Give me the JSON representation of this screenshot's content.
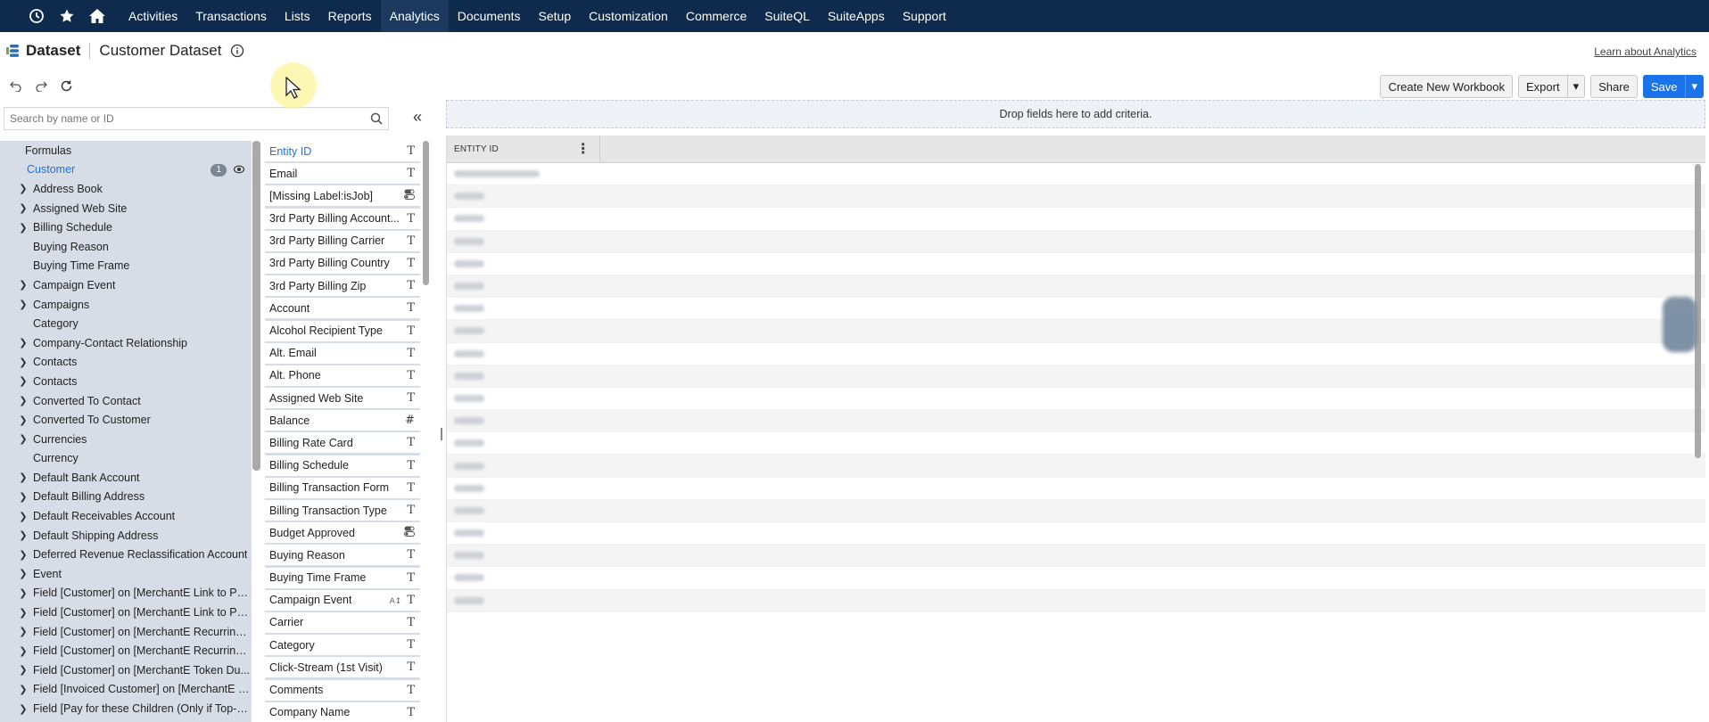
{
  "nav": {
    "items": [
      "Activities",
      "Transactions",
      "Lists",
      "Reports",
      "Analytics",
      "Documents",
      "Setup",
      "Customization",
      "Commerce",
      "SuiteQL",
      "SuiteApps",
      "Support"
    ],
    "active": "Analytics"
  },
  "header": {
    "title": "Dataset",
    "subtitle": "Customer Dataset",
    "learn_link": "Learn about Analytics"
  },
  "actions": {
    "create_workbook": "Create New Workbook",
    "export": "Export",
    "share": "Share",
    "save": "Save"
  },
  "search": {
    "placeholder": "Search by name or ID"
  },
  "tree": {
    "formulas": "Formulas",
    "customer": "Customer",
    "customer_badge": "1",
    "items": [
      {
        "label": "Address Book",
        "expandable": true
      },
      {
        "label": "Assigned Web Site",
        "expandable": true
      },
      {
        "label": "Billing Schedule",
        "expandable": true
      },
      {
        "label": "Buying Reason",
        "expandable": false
      },
      {
        "label": "Buying Time Frame",
        "expandable": false
      },
      {
        "label": "Campaign Event",
        "expandable": true
      },
      {
        "label": "Campaigns",
        "expandable": true
      },
      {
        "label": "Category",
        "expandable": false
      },
      {
        "label": "Company-Contact Relationship",
        "expandable": true
      },
      {
        "label": "Contacts",
        "expandable": true
      },
      {
        "label": "Contacts",
        "expandable": true
      },
      {
        "label": "Converted To Contact",
        "expandable": true
      },
      {
        "label": "Converted To Customer",
        "expandable": true
      },
      {
        "label": "Currencies",
        "expandable": true
      },
      {
        "label": "Currency",
        "expandable": false
      },
      {
        "label": "Default Bank Account",
        "expandable": true
      },
      {
        "label": "Default Billing Address",
        "expandable": true
      },
      {
        "label": "Default Receivables Account",
        "expandable": true
      },
      {
        "label": "Default Shipping Address",
        "expandable": true
      },
      {
        "label": "Deferred Revenue Reclassification Account",
        "expandable": true
      },
      {
        "label": "Event",
        "expandable": true
      },
      {
        "label": "Field [Customer] on [MerchantE Link to Pa...",
        "expandable": true
      },
      {
        "label": "Field [Customer] on [MerchantE Link to Pa...",
        "expandable": true
      },
      {
        "label": "Field [Customer] on [MerchantE Recurring ...",
        "expandable": true
      },
      {
        "label": "Field [Customer] on [MerchantE Recurring ...",
        "expandable": true
      },
      {
        "label": "Field [Customer] on [MerchantE Token Du...",
        "expandable": true
      },
      {
        "label": "Field [Invoiced Customer] on [MerchantE R...",
        "expandable": true
      },
      {
        "label": "Field [Pay for these Children (Only if Top-Le...",
        "expandable": true
      }
    ]
  },
  "fields": [
    {
      "label": "Entity ID",
      "type": "text",
      "active": true
    },
    {
      "label": "Email",
      "type": "text"
    },
    {
      "label": "[Missing Label:isJob]",
      "type": "toggle"
    },
    {
      "label": "3rd Party Billing Account...",
      "type": "text"
    },
    {
      "label": "3rd Party Billing Carrier",
      "type": "text"
    },
    {
      "label": "3rd Party Billing Country",
      "type": "text"
    },
    {
      "label": "3rd Party Billing Zip",
      "type": "text"
    },
    {
      "label": "Account",
      "type": "text"
    },
    {
      "label": "Alcohol Recipient Type",
      "type": "text"
    },
    {
      "label": "Alt. Email",
      "type": "text"
    },
    {
      "label": "Alt. Phone",
      "type": "text"
    },
    {
      "label": "Assigned Web Site",
      "type": "text"
    },
    {
      "label": "Balance",
      "type": "number"
    },
    {
      "label": "Billing Rate Card",
      "type": "text"
    },
    {
      "label": "Billing Schedule",
      "type": "text"
    },
    {
      "label": "Billing Transaction Form",
      "type": "text"
    },
    {
      "label": "Billing Transaction Type",
      "type": "text"
    },
    {
      "label": "Budget Approved",
      "type": "toggle"
    },
    {
      "label": "Buying Reason",
      "type": "text"
    },
    {
      "label": "Buying Time Frame",
      "type": "text"
    },
    {
      "label": "Campaign Event",
      "type": "sort-text"
    },
    {
      "label": "Carrier",
      "type": "text"
    },
    {
      "label": "Category",
      "type": "text"
    },
    {
      "label": "Click-Stream (1st Visit)",
      "type": "text"
    },
    {
      "label": "Comments",
      "type": "text"
    },
    {
      "label": "Company Name",
      "type": "text"
    }
  ],
  "criteria": {
    "drop_hint": "Drop fields here to add criteria."
  },
  "grid": {
    "column": "ENTITY ID",
    "rows": 20
  },
  "colors": {
    "nav_bg": "#0e2a4d",
    "panel_bg": "#d7dde6",
    "accent": "#1a73e8"
  }
}
